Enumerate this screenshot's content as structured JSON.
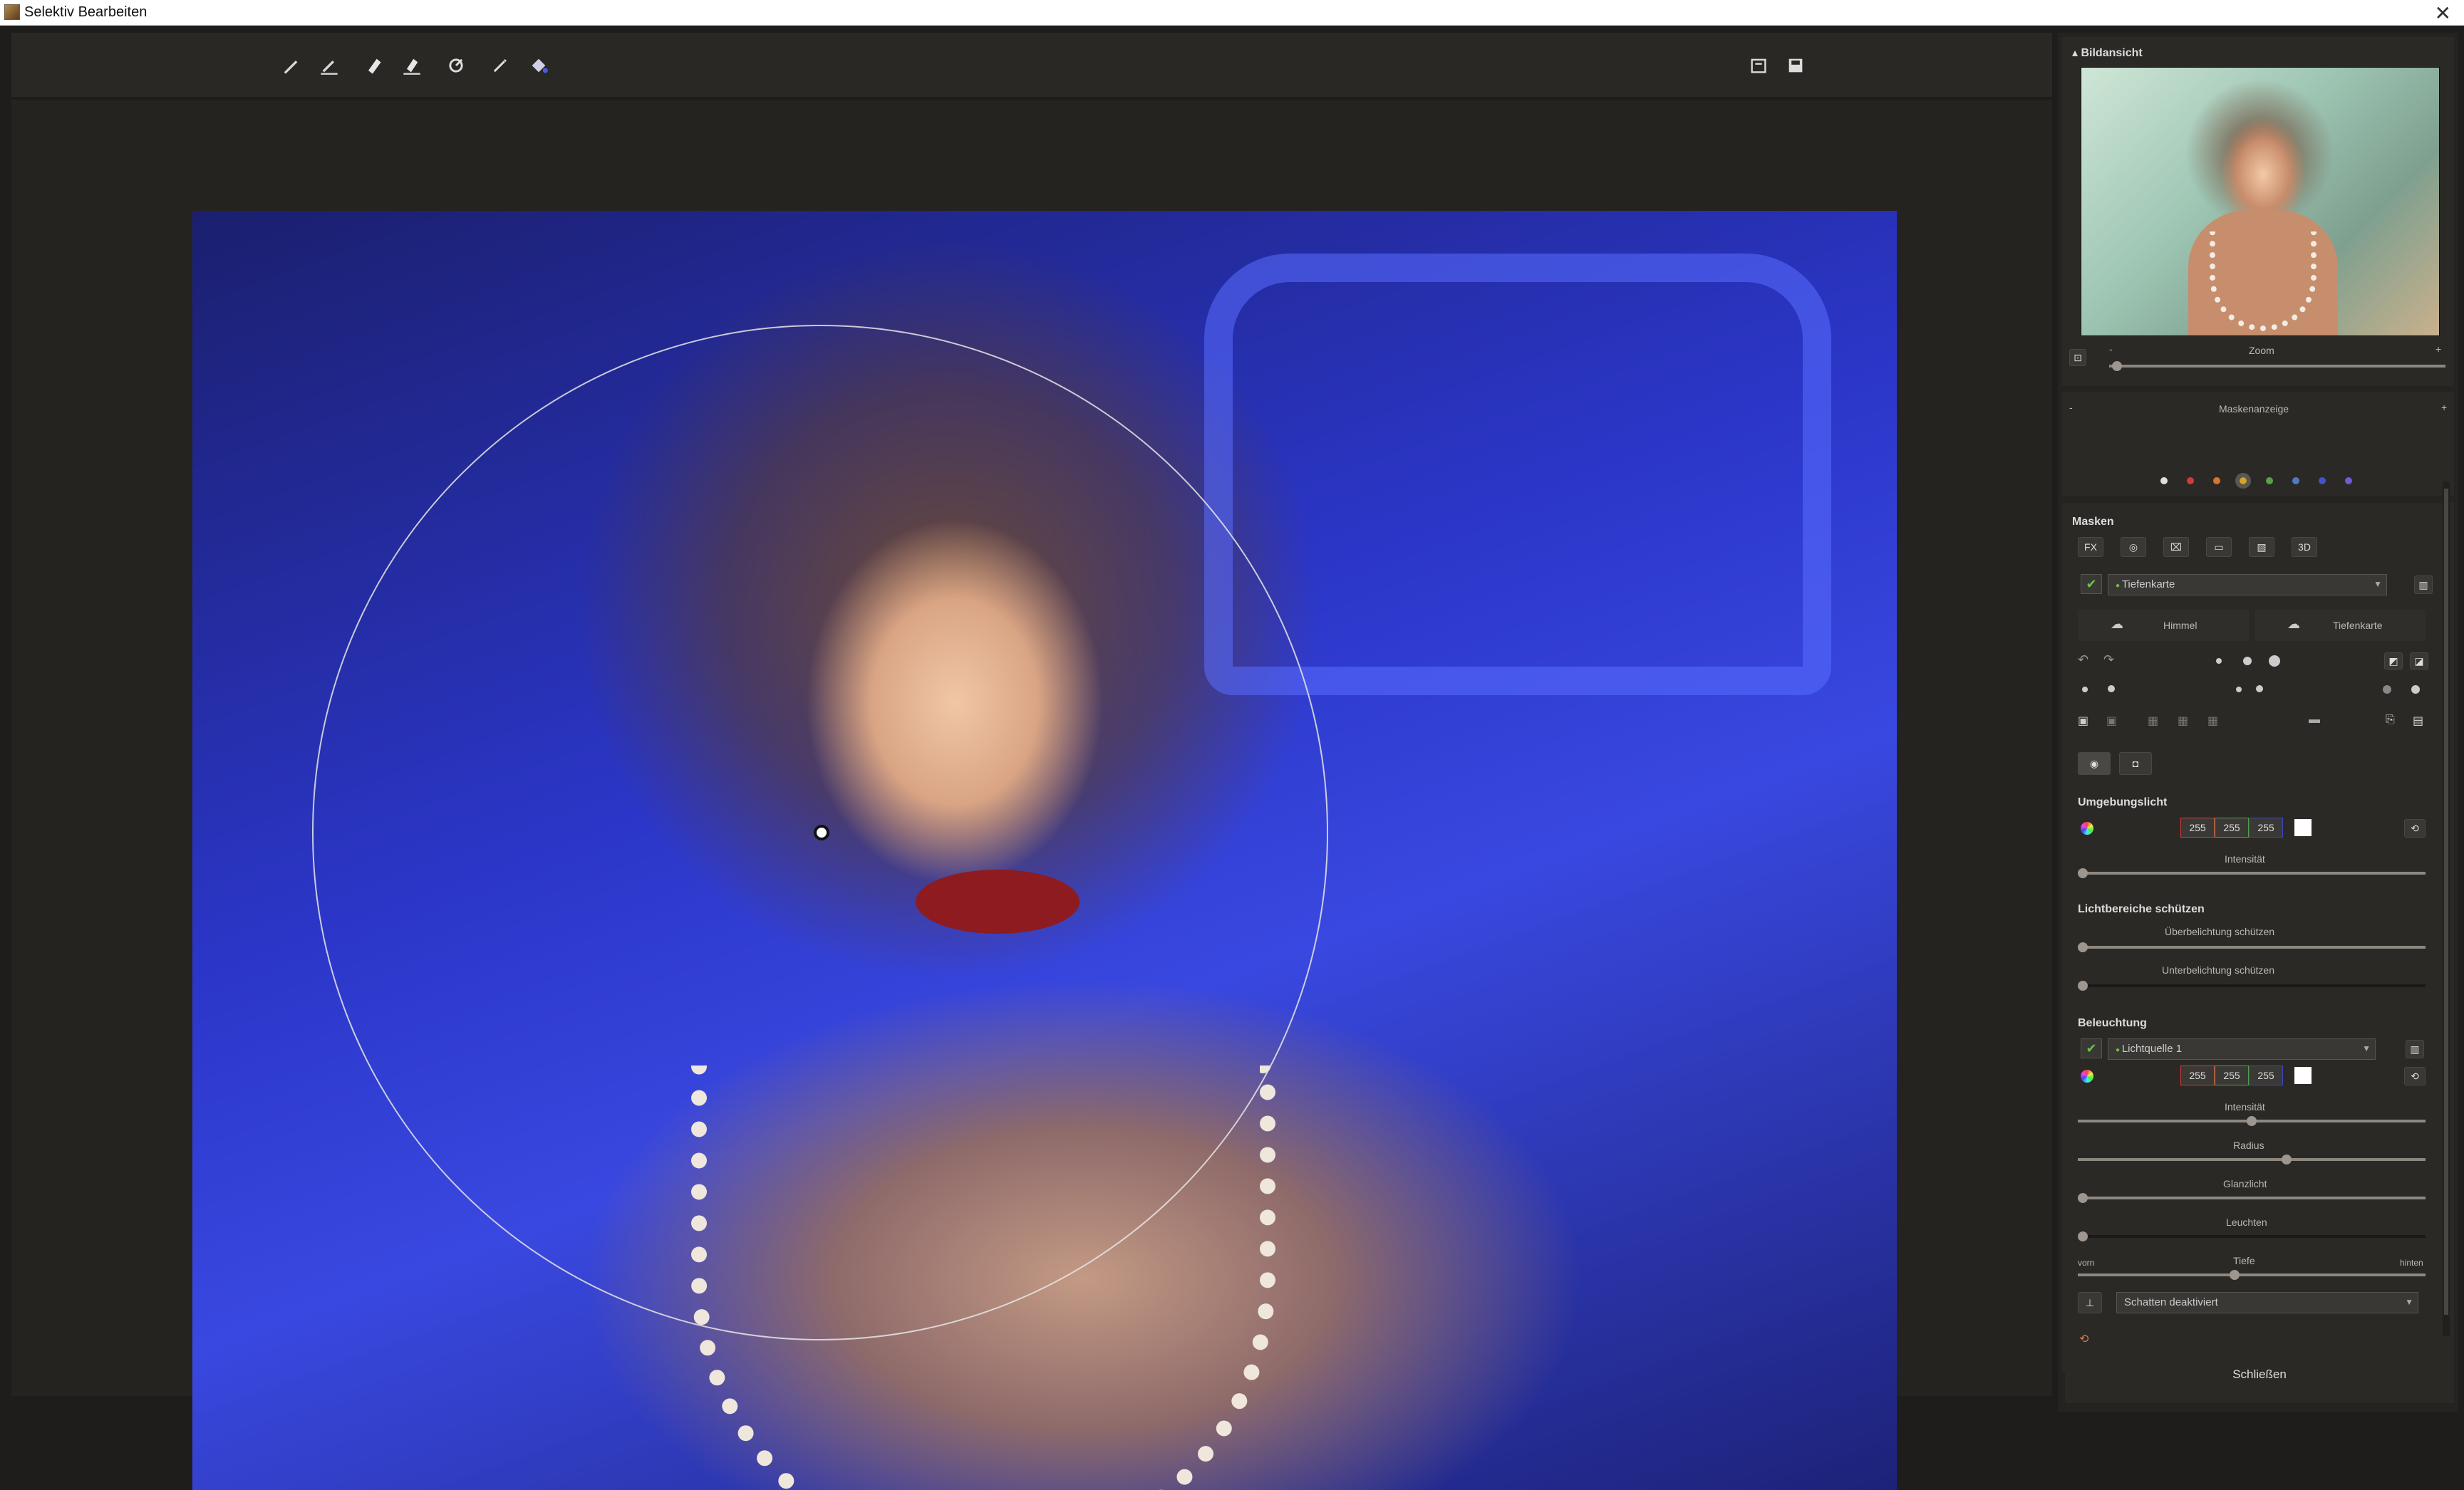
{
  "window": {
    "title": "Selektiv Bearbeiten",
    "close_label": "✕"
  },
  "toolbar": {
    "tools": [
      "brush-icon",
      "brush-plus-icon",
      "eraser-icon",
      "eraser-plus-icon",
      "refresh-brush-icon",
      "wand-icon",
      "fill-icon"
    ],
    "right_tools": [
      "export-mask-icon",
      "save-mask-icon"
    ]
  },
  "colors": {
    "accent_green": "#6cc04a",
    "red": "#d43a3a",
    "blue": "#3a46c8",
    "panel_bg": "#252320"
  },
  "panel": {
    "preview": {
      "title": "Bildansicht",
      "zoom_label": "Zoom",
      "zoom_minus": "-",
      "zoom_plus": "+",
      "zoom": 0.02
    },
    "mask_display": {
      "title": "Maskenanzeige",
      "minus": "-",
      "plus": "+",
      "dots": [
        "#e0e0e0",
        "#d23b3b",
        "#d8742f",
        "#d7a428",
        "#5aa04a",
        "#4f79c4",
        "#4650c8",
        "#6f5bd2"
      ]
    },
    "masks": {
      "title": "Masken",
      "type_buttons": [
        "FX",
        "◎",
        "⌧",
        "▭",
        "▧",
        "3D"
      ],
      "mask_select": "Tiefenkarte",
      "tabs": [
        "Himmel",
        "Tiefenkarte"
      ],
      "ambient": {
        "title": "Umgebungslicht",
        "r": "255",
        "g": "255",
        "b": "255",
        "intensity_label": "Intensität",
        "intensity": 0.0
      },
      "protect": {
        "title": "Lichtbereiche schützen",
        "over_label": "Überbelichtung schützen",
        "under_label": "Unterbelichtung schützen",
        "over": 0.0,
        "under": 0.0
      },
      "lighting": {
        "title": "Beleuchtung",
        "source_select": "Lichtquelle 1",
        "r": "255",
        "g": "255",
        "b": "255",
        "intensity_label": "Intensität",
        "intensity": 0.5,
        "radius_label": "Radius",
        "radius": 0.6,
        "gloss_label": "Glanzlicht",
        "gloss": 0.0,
        "glow_label": "Leuchten",
        "glow": 0.0,
        "depth_label": "Tiefe",
        "depth_front": "vorn",
        "depth_back": "hinten",
        "depth": 0.45,
        "shadow_select": "Schatten deaktiviert"
      }
    },
    "close_label": "Schließen"
  }
}
